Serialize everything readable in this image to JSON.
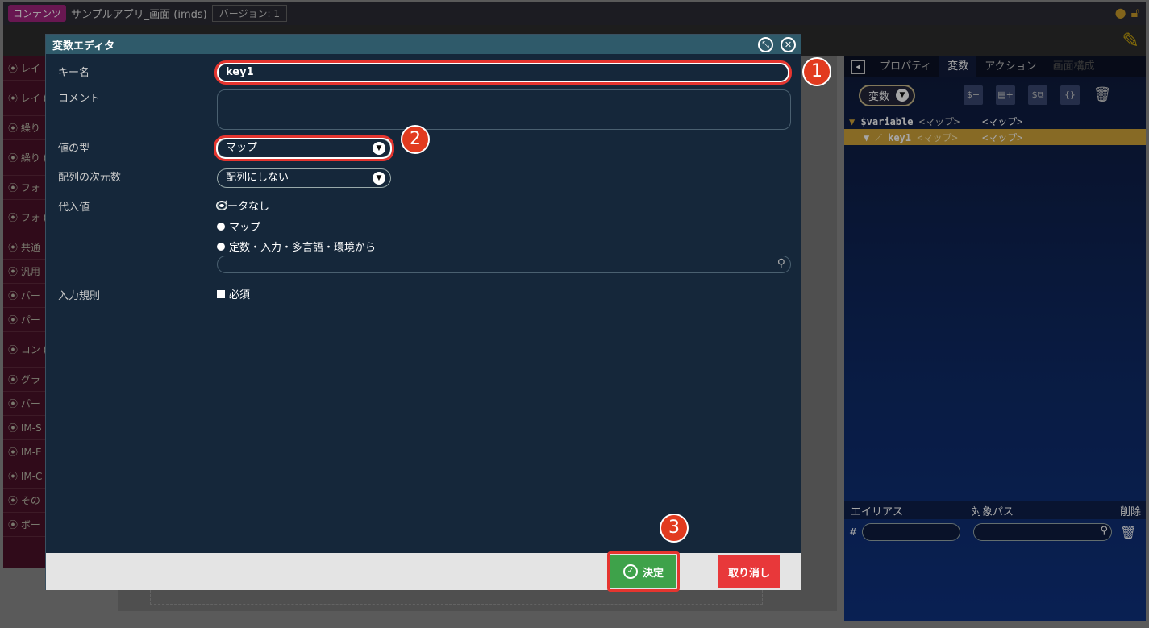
{
  "app": {
    "tag": "コンテンツ",
    "title": "サンプルアプリ_画面 (imds)",
    "version": "バージョン: 1"
  },
  "left_panel": {
    "items": [
      "⦿ レイ",
      "⦿ レイ (imds)",
      "⦿ 繰り",
      "⦿ 繰り (imds)",
      "⦿ フォ",
      "⦿ フォ (imds)",
      "⦿ 共通",
      "⦿ 汎用",
      "⦿ パー",
      "⦿ パー",
      "⦿ コン (imds)",
      "⦿ グラ",
      "⦿ パー",
      "⦿ IM-S",
      "⦿ IM-E",
      "⦿ IM-C",
      "⦿ その",
      "⦿ ボー"
    ]
  },
  "right_panel": {
    "tabs": [
      "プロパティ",
      "変数",
      "アクション",
      "画面構成"
    ],
    "active_tab": "変数",
    "var_select": "変数",
    "tree": [
      {
        "name": "$variable",
        "type": "<マップ>",
        "type2": "<マップ>"
      },
      {
        "name": "key1",
        "type": "<マップ>",
        "type2": "<マップ>"
      }
    ],
    "alias": {
      "col_alias": "エイリアス",
      "col_path": "対象パス",
      "col_delete": "削除",
      "hash": "#"
    }
  },
  "dialog": {
    "title": "変数エディタ",
    "labels": {
      "key": "キー名",
      "comment": "コメント",
      "type": "値の型",
      "array_dim": "配列の次元数",
      "value": "代入値",
      "rule": "入力規則"
    },
    "key_value": "key1",
    "comment_value": "",
    "type_value": "マップ",
    "array_value": "配列にしない",
    "radio_options": [
      "データなし",
      "マップ",
      "定数・入力・多言語・環境から"
    ],
    "radio_selected": "データなし",
    "required_label": "必須",
    "ok_label": "決定",
    "cancel_label": "取り消し"
  },
  "badges": [
    "1",
    "2",
    "3"
  ],
  "colors": {
    "highlight": "#e5352f",
    "ok": "#3ea24a",
    "cancel": "#e8383a",
    "dialog_bg": "#15273a"
  }
}
